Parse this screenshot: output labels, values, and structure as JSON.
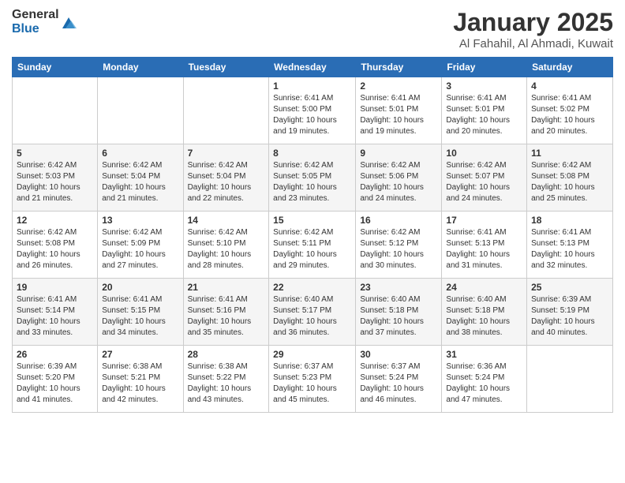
{
  "logo": {
    "general": "General",
    "blue": "Blue"
  },
  "header": {
    "title": "January 2025",
    "subtitle": "Al Fahahil, Al Ahmadi, Kuwait"
  },
  "weekdays": [
    "Sunday",
    "Monday",
    "Tuesday",
    "Wednesday",
    "Thursday",
    "Friday",
    "Saturday"
  ],
  "weeks": [
    [
      {
        "day": "",
        "sunrise": "",
        "sunset": "",
        "daylight": ""
      },
      {
        "day": "",
        "sunrise": "",
        "sunset": "",
        "daylight": ""
      },
      {
        "day": "",
        "sunrise": "",
        "sunset": "",
        "daylight": ""
      },
      {
        "day": "1",
        "sunrise": "Sunrise: 6:41 AM",
        "sunset": "Sunset: 5:00 PM",
        "daylight": "Daylight: 10 hours and 19 minutes."
      },
      {
        "day": "2",
        "sunrise": "Sunrise: 6:41 AM",
        "sunset": "Sunset: 5:01 PM",
        "daylight": "Daylight: 10 hours and 19 minutes."
      },
      {
        "day": "3",
        "sunrise": "Sunrise: 6:41 AM",
        "sunset": "Sunset: 5:01 PM",
        "daylight": "Daylight: 10 hours and 20 minutes."
      },
      {
        "day": "4",
        "sunrise": "Sunrise: 6:41 AM",
        "sunset": "Sunset: 5:02 PM",
        "daylight": "Daylight: 10 hours and 20 minutes."
      }
    ],
    [
      {
        "day": "5",
        "sunrise": "Sunrise: 6:42 AM",
        "sunset": "Sunset: 5:03 PM",
        "daylight": "Daylight: 10 hours and 21 minutes."
      },
      {
        "day": "6",
        "sunrise": "Sunrise: 6:42 AM",
        "sunset": "Sunset: 5:04 PM",
        "daylight": "Daylight: 10 hours and 21 minutes."
      },
      {
        "day": "7",
        "sunrise": "Sunrise: 6:42 AM",
        "sunset": "Sunset: 5:04 PM",
        "daylight": "Daylight: 10 hours and 22 minutes."
      },
      {
        "day": "8",
        "sunrise": "Sunrise: 6:42 AM",
        "sunset": "Sunset: 5:05 PM",
        "daylight": "Daylight: 10 hours and 23 minutes."
      },
      {
        "day": "9",
        "sunrise": "Sunrise: 6:42 AM",
        "sunset": "Sunset: 5:06 PM",
        "daylight": "Daylight: 10 hours and 24 minutes."
      },
      {
        "day": "10",
        "sunrise": "Sunrise: 6:42 AM",
        "sunset": "Sunset: 5:07 PM",
        "daylight": "Daylight: 10 hours and 24 minutes."
      },
      {
        "day": "11",
        "sunrise": "Sunrise: 6:42 AM",
        "sunset": "Sunset: 5:08 PM",
        "daylight": "Daylight: 10 hours and 25 minutes."
      }
    ],
    [
      {
        "day": "12",
        "sunrise": "Sunrise: 6:42 AM",
        "sunset": "Sunset: 5:08 PM",
        "daylight": "Daylight: 10 hours and 26 minutes."
      },
      {
        "day": "13",
        "sunrise": "Sunrise: 6:42 AM",
        "sunset": "Sunset: 5:09 PM",
        "daylight": "Daylight: 10 hours and 27 minutes."
      },
      {
        "day": "14",
        "sunrise": "Sunrise: 6:42 AM",
        "sunset": "Sunset: 5:10 PM",
        "daylight": "Daylight: 10 hours and 28 minutes."
      },
      {
        "day": "15",
        "sunrise": "Sunrise: 6:42 AM",
        "sunset": "Sunset: 5:11 PM",
        "daylight": "Daylight: 10 hours and 29 minutes."
      },
      {
        "day": "16",
        "sunrise": "Sunrise: 6:42 AM",
        "sunset": "Sunset: 5:12 PM",
        "daylight": "Daylight: 10 hours and 30 minutes."
      },
      {
        "day": "17",
        "sunrise": "Sunrise: 6:41 AM",
        "sunset": "Sunset: 5:13 PM",
        "daylight": "Daylight: 10 hours and 31 minutes."
      },
      {
        "day": "18",
        "sunrise": "Sunrise: 6:41 AM",
        "sunset": "Sunset: 5:13 PM",
        "daylight": "Daylight: 10 hours and 32 minutes."
      }
    ],
    [
      {
        "day": "19",
        "sunrise": "Sunrise: 6:41 AM",
        "sunset": "Sunset: 5:14 PM",
        "daylight": "Daylight: 10 hours and 33 minutes."
      },
      {
        "day": "20",
        "sunrise": "Sunrise: 6:41 AM",
        "sunset": "Sunset: 5:15 PM",
        "daylight": "Daylight: 10 hours and 34 minutes."
      },
      {
        "day": "21",
        "sunrise": "Sunrise: 6:41 AM",
        "sunset": "Sunset: 5:16 PM",
        "daylight": "Daylight: 10 hours and 35 minutes."
      },
      {
        "day": "22",
        "sunrise": "Sunrise: 6:40 AM",
        "sunset": "Sunset: 5:17 PM",
        "daylight": "Daylight: 10 hours and 36 minutes."
      },
      {
        "day": "23",
        "sunrise": "Sunrise: 6:40 AM",
        "sunset": "Sunset: 5:18 PM",
        "daylight": "Daylight: 10 hours and 37 minutes."
      },
      {
        "day": "24",
        "sunrise": "Sunrise: 6:40 AM",
        "sunset": "Sunset: 5:18 PM",
        "daylight": "Daylight: 10 hours and 38 minutes."
      },
      {
        "day": "25",
        "sunrise": "Sunrise: 6:39 AM",
        "sunset": "Sunset: 5:19 PM",
        "daylight": "Daylight: 10 hours and 40 minutes."
      }
    ],
    [
      {
        "day": "26",
        "sunrise": "Sunrise: 6:39 AM",
        "sunset": "Sunset: 5:20 PM",
        "daylight": "Daylight: 10 hours and 41 minutes."
      },
      {
        "day": "27",
        "sunrise": "Sunrise: 6:38 AM",
        "sunset": "Sunset: 5:21 PM",
        "daylight": "Daylight: 10 hours and 42 minutes."
      },
      {
        "day": "28",
        "sunrise": "Sunrise: 6:38 AM",
        "sunset": "Sunset: 5:22 PM",
        "daylight": "Daylight: 10 hours and 43 minutes."
      },
      {
        "day": "29",
        "sunrise": "Sunrise: 6:37 AM",
        "sunset": "Sunset: 5:23 PM",
        "daylight": "Daylight: 10 hours and 45 minutes."
      },
      {
        "day": "30",
        "sunrise": "Sunrise: 6:37 AM",
        "sunset": "Sunset: 5:24 PM",
        "daylight": "Daylight: 10 hours and 46 minutes."
      },
      {
        "day": "31",
        "sunrise": "Sunrise: 6:36 AM",
        "sunset": "Sunset: 5:24 PM",
        "daylight": "Daylight: 10 hours and 47 minutes."
      },
      {
        "day": "",
        "sunrise": "",
        "sunset": "",
        "daylight": ""
      }
    ]
  ]
}
